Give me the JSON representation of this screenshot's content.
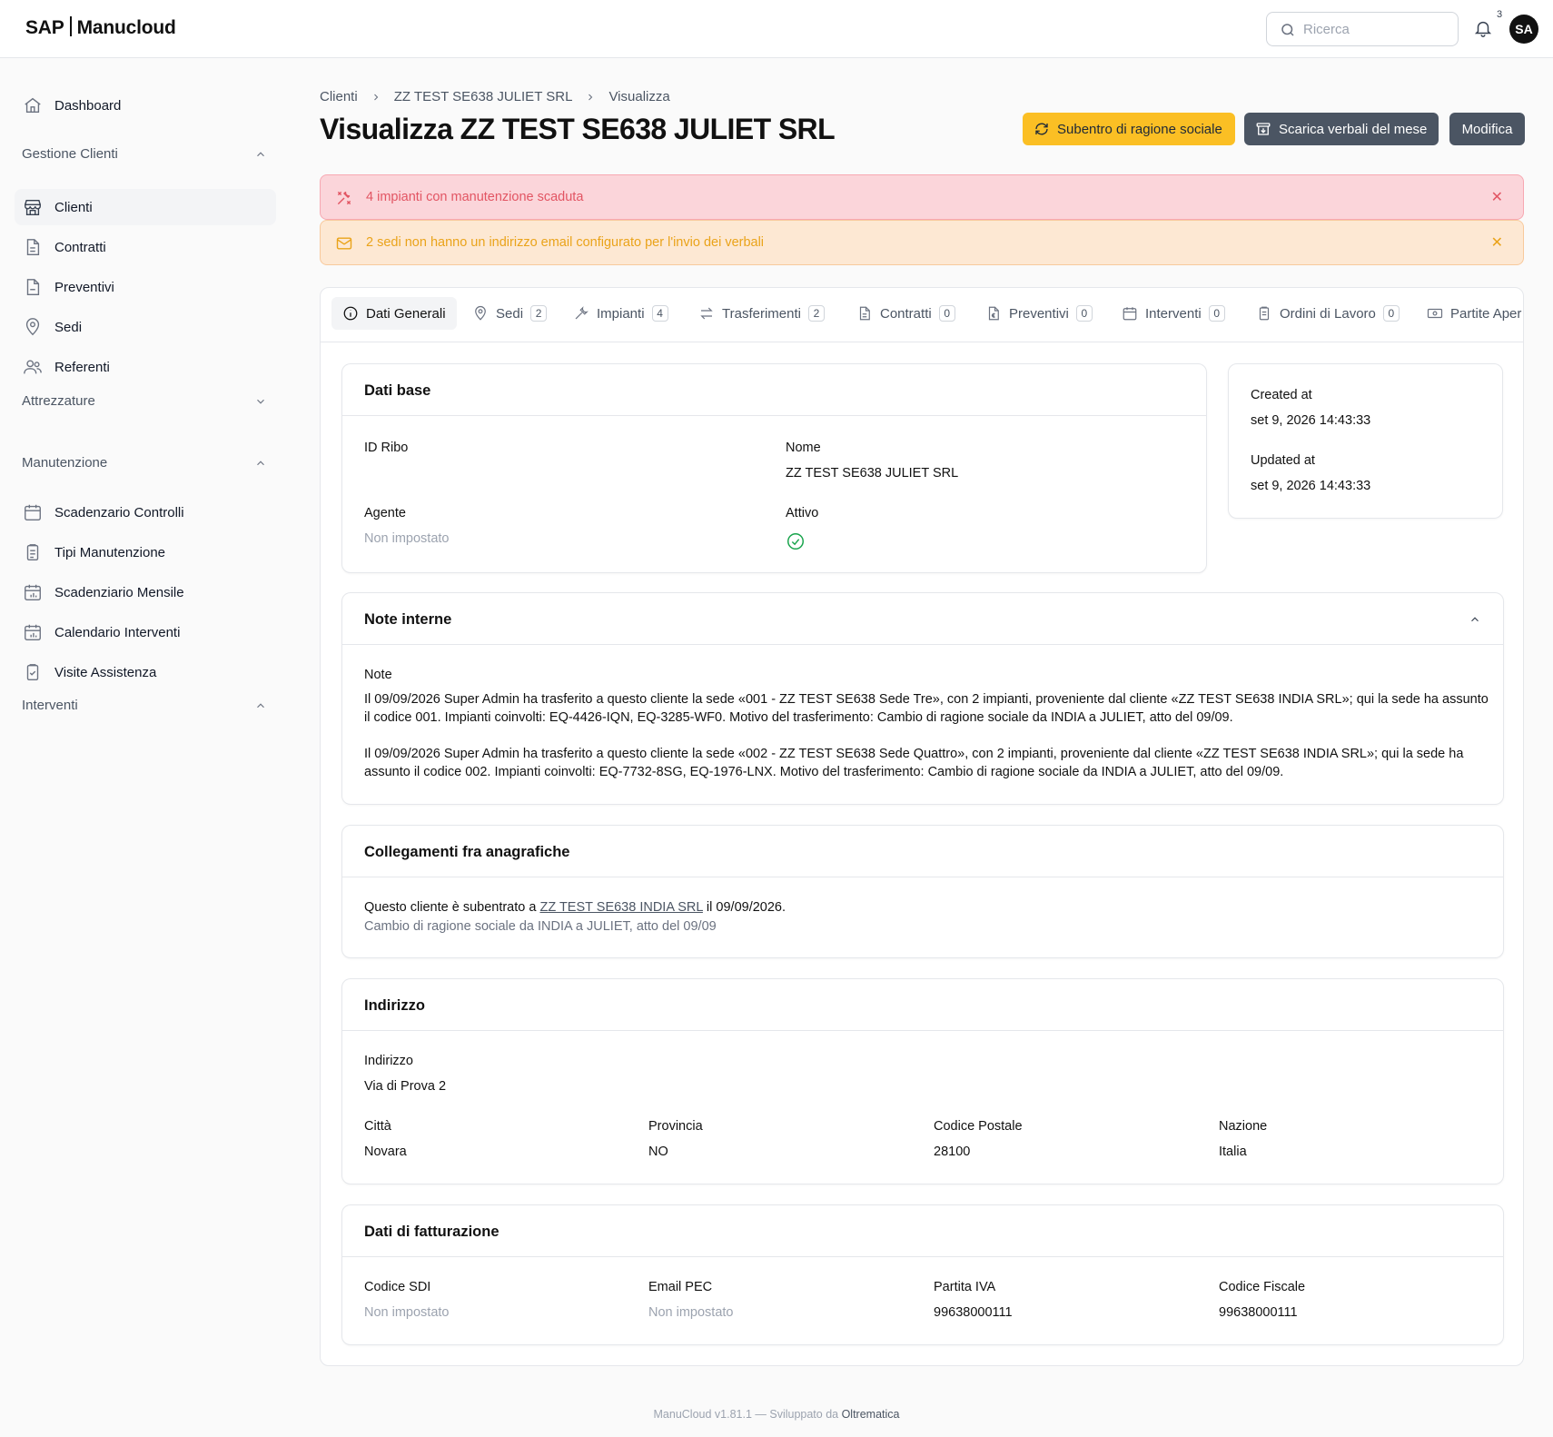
{
  "app": {
    "brand_left": "SAP",
    "brand_right": "Manucloud"
  },
  "topbar": {
    "search_placeholder": "Ricerca",
    "notif_count": "3",
    "avatar_initials": "SA"
  },
  "sidebar": {
    "dashboard": "Dashboard",
    "group_clienti": "Gestione Clienti",
    "clienti_items": [
      "Clienti",
      "Contratti",
      "Preventivi",
      "Sedi",
      "Referenti"
    ],
    "group_attrezzature": "Attrezzature",
    "group_manutenzione": "Manutenzione",
    "manutenzione_items": [
      "Scadenzario Controlli",
      "Tipi Manutenzione",
      "Scadenziario Mensile",
      "Calendario Interventi",
      "Visite Assistenza"
    ],
    "group_interventi": "Interventi"
  },
  "breadcrumb": [
    "Clienti",
    "ZZ TEST SE638 JULIET SRL",
    "Visualizza"
  ],
  "page": {
    "title": "Visualizza ZZ TEST SE638 JULIET SRL"
  },
  "actions": {
    "subentro": "Subentro di ragione sociale",
    "scarica": "Scarica verbali del mese",
    "modifica": "Modifica"
  },
  "alerts": {
    "red": "4 impianti con manutenzione scaduta",
    "orange": "2 sedi non hanno un indirizzo email configurato per l'invio dei verbali"
  },
  "tabs": [
    {
      "label": "Dati Generali",
      "count": ""
    },
    {
      "label": "Sedi",
      "count": "2"
    },
    {
      "label": "Impianti",
      "count": "4"
    },
    {
      "label": "Trasferimenti",
      "count": "2"
    },
    {
      "label": "Contratti",
      "count": "0"
    },
    {
      "label": "Preventivi",
      "count": "0"
    },
    {
      "label": "Interventi",
      "count": "0"
    },
    {
      "label": "Ordini di Lavoro",
      "count": "0"
    },
    {
      "label": "Partite Aper",
      "count": ""
    }
  ],
  "dati_base": {
    "title": "Dati base",
    "id_ribo_label": "ID Ribo",
    "id_ribo_value": "",
    "nome_label": "Nome",
    "nome_value": "ZZ TEST SE638 JULIET SRL",
    "agente_label": "Agente",
    "agente_value": "Non impostato",
    "attivo_label": "Attivo"
  },
  "meta": {
    "created_label": "Created at",
    "created_value": "set 9, 2026 14:43:33",
    "updated_label": "Updated at",
    "updated_value": "set 9, 2026 14:43:33"
  },
  "note_interne": {
    "title": "Note interne",
    "label": "Note",
    "p1": "Il 09/09/2026 Super Admin ha trasferito a questo cliente la sede «001 - ZZ TEST SE638 Sede Tre», con 2 impianti, proveniente dal cliente «ZZ TEST SE638 INDIA SRL»; qui la sede ha assunto il codice 001. Impianti coinvolti: EQ-4426-IQN, EQ-3285-WF0. Motivo del trasferimento: Cambio di ragione sociale da INDIA a JULIET, atto del 09/09.",
    "p2": "Il 09/09/2026 Super Admin ha trasferito a questo cliente la sede «002 - ZZ TEST SE638 Sede Quattro», con 2 impianti, proveniente dal cliente «ZZ TEST SE638 INDIA SRL»; qui la sede ha assunto il codice 002. Impianti coinvolti: EQ-7732-8SG, EQ-1976-LNX. Motivo del trasferimento: Cambio di ragione sociale da INDIA a JULIET, atto del 09/09."
  },
  "collegamenti": {
    "title": "Collegamenti fra anagrafiche",
    "text_before": "Questo cliente è subentrato a ",
    "link": "ZZ TEST SE638 INDIA SRL",
    "text_after": " il 09/09/2026.",
    "reason": "Cambio di ragione sociale da INDIA a JULIET, atto del 09/09"
  },
  "indirizzo": {
    "title": "Indirizzo",
    "indirizzo_label": "Indirizzo",
    "indirizzo_value": "Via di Prova 2",
    "citta_label": "Città",
    "citta_value": "Novara",
    "provincia_label": "Provincia",
    "provincia_value": "NO",
    "cap_label": "Codice Postale",
    "cap_value": "28100",
    "nazione_label": "Nazione",
    "nazione_value": "Italia"
  },
  "fatturazione": {
    "title": "Dati di fatturazione",
    "sdi_label": "Codice SDI",
    "sdi_value": "Non impostato",
    "pec_label": "Email PEC",
    "pec_value": "Non impostato",
    "piva_label": "Partita IVA",
    "piva_value": "99638000111",
    "cf_label": "Codice Fiscale",
    "cf_value": "99638000111"
  },
  "footer": {
    "text": "ManuCloud v1.81.1 — Sviluppato da ",
    "dev": "Oltrematica"
  },
  "colors": {
    "accent_yellow": "#fbbf24",
    "dark_button": "#4b5563",
    "alert_red_bg": "#fbd5da",
    "alert_orange_bg": "#fde8d3",
    "active_green": "#16a34a"
  }
}
